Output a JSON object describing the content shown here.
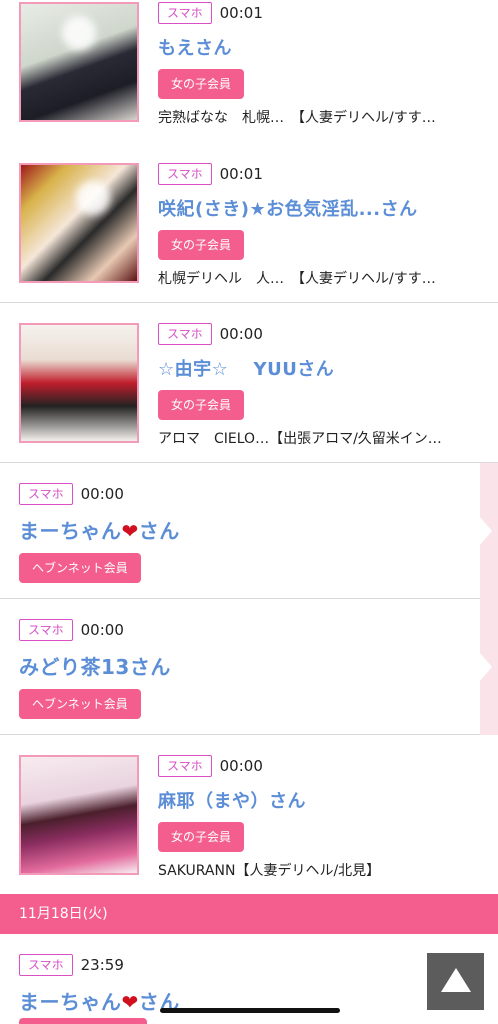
{
  "rows": [
    {
      "device": "スマホ",
      "time": "00:01",
      "name": "もえさん",
      "member": "女の子会員",
      "info": "完熟ばなな　札幌…　【人妻デリヘル/すす…"
    },
    {
      "device": "スマホ",
      "time": "00:01",
      "name": "咲紀(さき)★お色気淫乱...さん",
      "member": "女の子会員",
      "info": "札幌デリヘル　人…　【人妻デリヘル/すす…"
    },
    {
      "device": "スマホ",
      "time": "00:00",
      "name": "☆由宇☆　 YUUさん",
      "member": "女の子会員",
      "info": "アロマ　CIELO…【出張アロマ/久留米イン…"
    },
    {
      "device": "スマホ",
      "time": "00:00",
      "name_pre": "まーちゃん",
      "heart": "❤",
      "name_post": "さん",
      "member": "ヘブンネット会員"
    },
    {
      "device": "スマホ",
      "time": "00:00",
      "name": "みどり茶13さん",
      "member": "ヘブンネット会員"
    },
    {
      "device": "スマホ",
      "time": "00:00",
      "name": "麻耶（まや）さん",
      "member": "女の子会員",
      "info": "SAKURANN【人妻デリヘル/北見】"
    },
    {
      "device": "スマホ",
      "time": "23:59",
      "name_pre": "まーちゃん",
      "heart": "❤",
      "name_post": "さん"
    }
  ],
  "date_header": "11月18日(火)",
  "colors": {
    "accent": "#f35e8e",
    "name": "#5b8ed6",
    "badge": "#d94fc6"
  },
  "icons": {
    "scroll_top": "triangle-up-icon"
  }
}
